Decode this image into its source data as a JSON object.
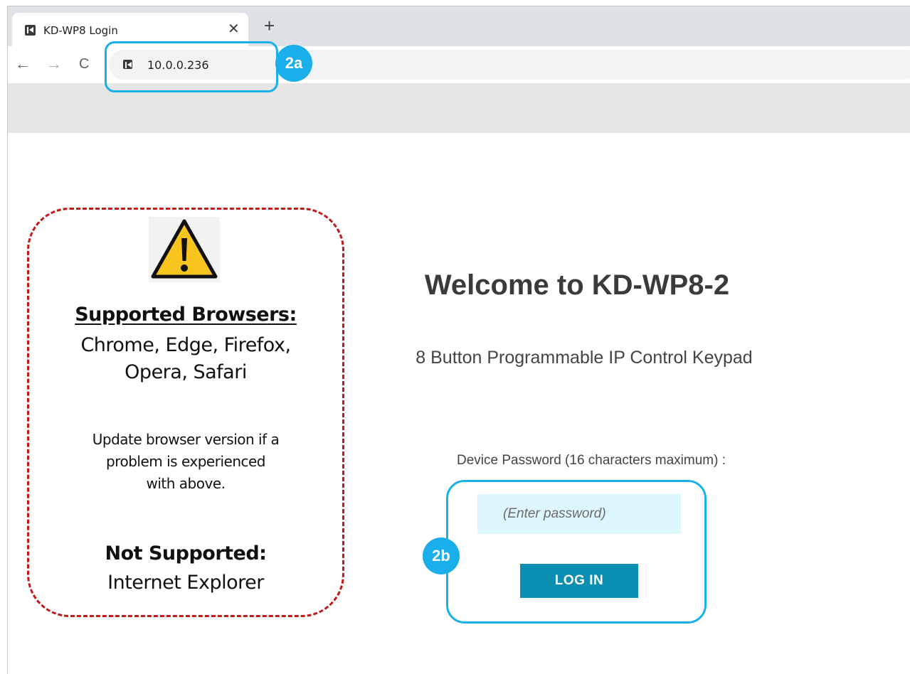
{
  "browser": {
    "tab_title": "KD-WP8 Login",
    "tab_close_icon": "close-icon",
    "new_tab_symbol": "+",
    "url": "10.0.0.236",
    "back_symbol": "←",
    "forward_symbol": "→",
    "reload_symbol": "C"
  },
  "callouts": {
    "address": "2a",
    "login": "2b",
    "color": "#1aaeea"
  },
  "notice": {
    "supported_heading": "Supported Browsers:",
    "supported_line1": "Chrome, Edge, Firefox,",
    "supported_line2": "Opera, Safari",
    "update_line1": "Update browser version if a",
    "update_line2": "problem is experienced",
    "update_line3": "with above.",
    "not_supported_heading": "Not Supported:",
    "not_supported_value": "Internet Explorer",
    "icon": "warning-icon",
    "border_color": "#c01a1a"
  },
  "main": {
    "title": "Welcome to KD-WP8-2",
    "subtitle": "8 Button Programmable IP Control Keypad",
    "password_label": "Device Password (16 characters maximum) :",
    "password_placeholder": "(Enter password)",
    "login_label": "LOG IN",
    "accent_color": "#0b8fb0"
  }
}
